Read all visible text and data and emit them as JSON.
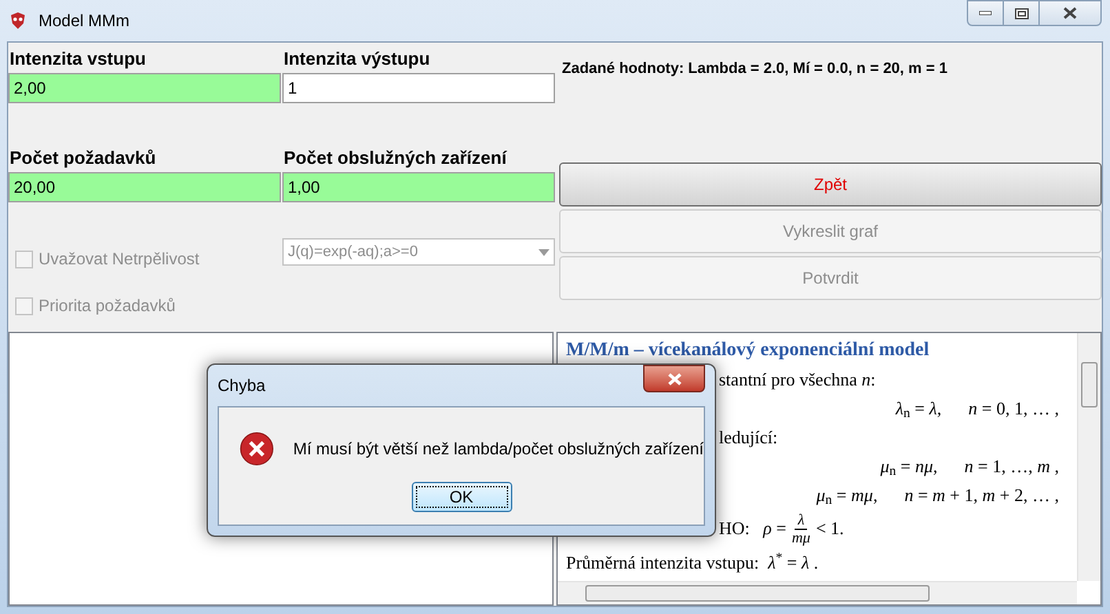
{
  "window": {
    "title": "Model MMm"
  },
  "fields": [
    {
      "label": "Intenzita vstupu",
      "value": "2,00",
      "highlighted": true
    },
    {
      "label": "Intenzita výstupu",
      "value": "1",
      "highlighted": false
    },
    {
      "label": "Počet požadavků",
      "value": "20,00",
      "highlighted": true
    },
    {
      "label": "Počet obslužných zařízení",
      "value": "1,00",
      "highlighted": true
    }
  ],
  "given_values": "Zadané hodnoty: Lambda = 2.0, Mí = 0.0, n = 20, m = 1",
  "checkboxes": [
    {
      "label": "Uvažovat Netrpělivost",
      "checked": false,
      "disabled": true
    },
    {
      "label": "Priorita požadavků",
      "checked": false,
      "disabled": true
    }
  ],
  "combo": {
    "value": "J(q)=exp(-aq);a>=0",
    "disabled": true
  },
  "buttons": [
    {
      "label": "Zpět",
      "disabled": false
    },
    {
      "label": "Vykreslit graf",
      "disabled": true
    },
    {
      "label": "Potvrdit",
      "disabled": true
    }
  ],
  "help": [
    {
      "kind": "heading",
      "text": "M/M/m – vícekanálový  exponenciální  model"
    },
    {
      "kind": "fragment",
      "text": "stantní pro všechna *n*:"
    },
    {
      "kind": "formula",
      "text": "*λ*$_{n}$ = *λ*,      *n* = 0, 1, … ,"
    },
    {
      "kind": "fragment",
      "text": "ledující:"
    },
    {
      "kind": "formula",
      "text": "*μ*$_{n}$ = *nμ*,      *n* = 1, …, *m* ,"
    },
    {
      "kind": "formula",
      "text": "*μ*$_{n}$ = *mμ*,      *n* = *m* + 1, *m* + 2, … ,"
    },
    {
      "kind": "fraction",
      "prefix": "HO:   *ρ* =",
      "numerator": "*λ*",
      "denominator": "*mμ*",
      "suffix": "< 1."
    },
    {
      "kind": "text",
      "text": "Průměrná intenzita vstupu:  *λ*$^{*}$ = *λ* ."
    }
  ],
  "dialog": {
    "title": "Chyba",
    "message": "Mí musí být větší než lambda/počet obslužných zařízení",
    "button": "OK"
  }
}
